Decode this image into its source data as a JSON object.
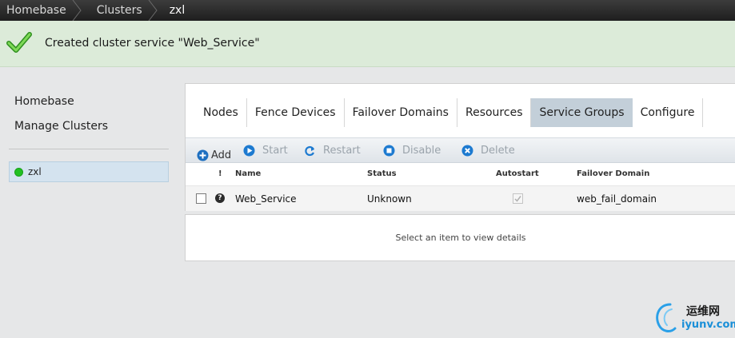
{
  "breadcrumb": [
    "Homebase",
    "Clusters",
    "zxl"
  ],
  "notification": {
    "message": "Created cluster service \"Web_Service\"",
    "status": "success"
  },
  "sidebar": {
    "links": [
      "Homebase",
      "Manage Clusters"
    ],
    "clusters": [
      {
        "name": "zxl",
        "status_color": "#22c022"
      }
    ]
  },
  "tabs": {
    "items": [
      "Nodes",
      "Fence Devices",
      "Failover Domains",
      "Resources",
      "Service Groups",
      "Configure"
    ],
    "active": "Service Groups"
  },
  "toolbar": {
    "add": "Add",
    "start": "Start",
    "restart": "Restart",
    "disable": "Disable",
    "delete": "Delete"
  },
  "table": {
    "columns": {
      "flag": "!",
      "name": "Name",
      "status": "Status",
      "autostart": "Autostart",
      "failover": "Failover Domain"
    },
    "rows": [
      {
        "name": "Web_Service",
        "status": "Unknown",
        "autostart": true,
        "failover_domain": "web_fail_domain",
        "icon": "help-icon"
      }
    ]
  },
  "details": {
    "placeholder": "Select an item to view details"
  },
  "watermark": {
    "line1": "运维网",
    "line2": "iyunv.com"
  },
  "colors": {
    "accent": "#1a8fd8",
    "notice_bg": "#dcebd9",
    "active_tab": "#c3cfd9"
  }
}
